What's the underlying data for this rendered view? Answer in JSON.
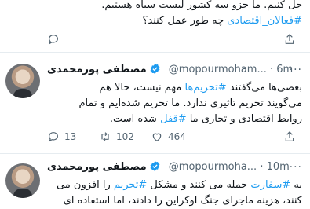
{
  "tweet_top": {
    "line1": "حل کنیم. ما جزو سه کشور لیست سیاه هستیم.",
    "line2_tag": "#فعالان_اقتصادی",
    "line2_rest": " چه طور عمل کنند؟"
  },
  "tweet_main": {
    "author_name": "مصطفی پورمحمدی",
    "handle": "@mopourmoham...",
    "time": "· 6m",
    "line1_pre": "بعضی‌ها می‌گفتند ",
    "line1_tag": "#تحریم‌ها",
    "line1_post": " مهم نیست، حالا هم",
    "line2": "می‌گویند تحریم تاثیری ندارد. ما تحریم شده‌ایم و تمام",
    "line3_pre": "روابط اقتصادی و تجاری ما ",
    "line3_tag": "#قفل",
    "line3_post": " شده است.",
    "replies": "13",
    "retweets": "102",
    "likes": "464"
  },
  "tweet_bottom": {
    "author_name": "مصطفی پورمحمدی",
    "handle": "@mopourmoha...",
    "time": "· 10m",
    "line1_pre": "به ",
    "line1_tag": "#سفارت",
    "line1_mid": " حمله می کنند و مشکل ",
    "line1_tag2": "#تحریم",
    "line1_post": " را افزون می",
    "line2": "کنند، هزینه ماجرای جنگ اوکراین را دادند، اما استفاده ای"
  }
}
